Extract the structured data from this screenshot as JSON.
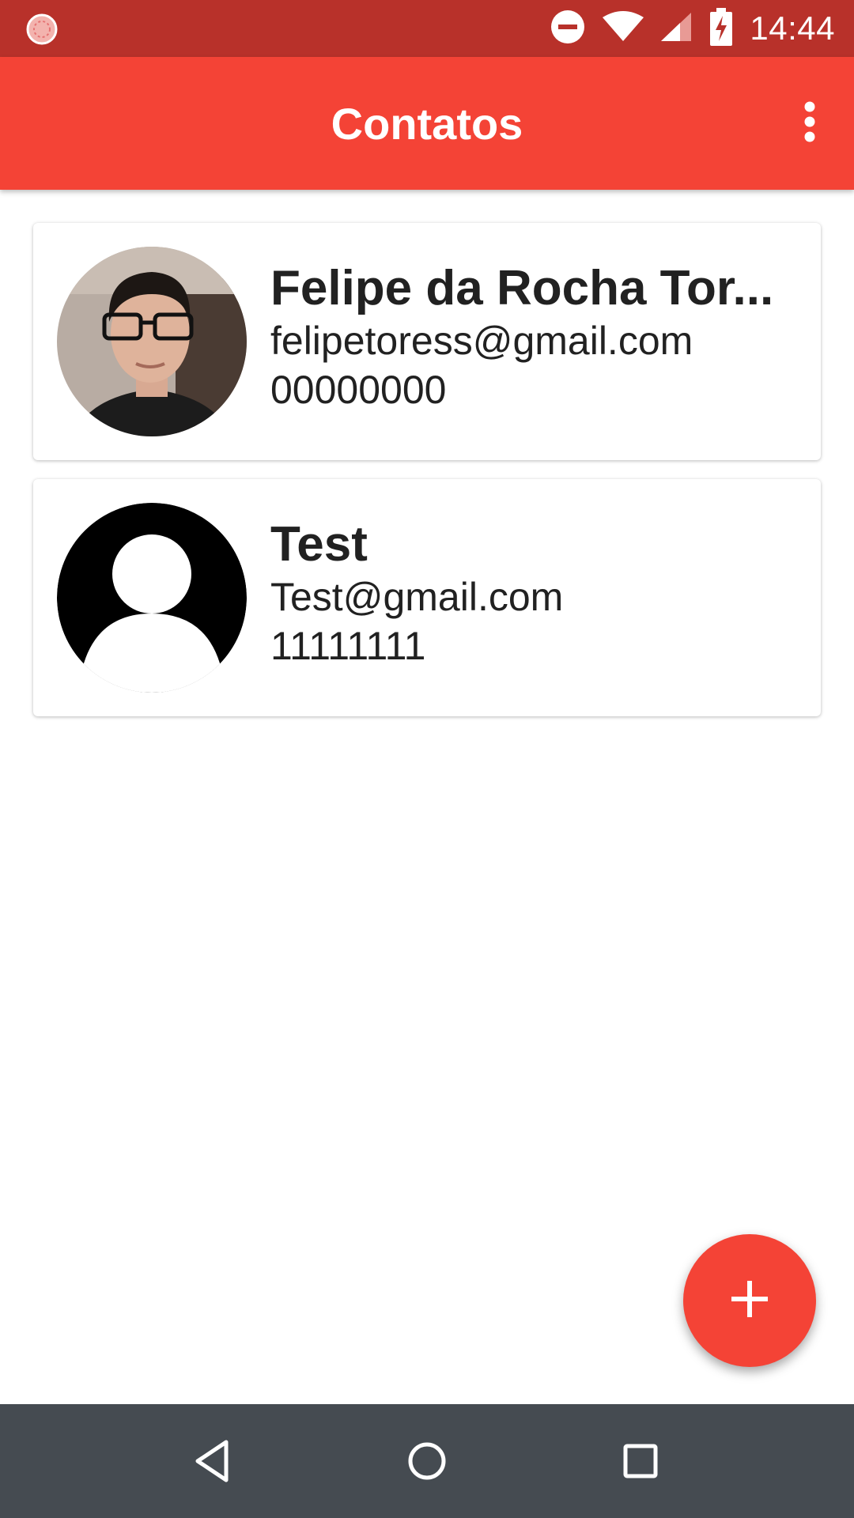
{
  "status_bar": {
    "time": "14:44",
    "icons": [
      "app-notification-icon",
      "do-not-disturb-icon",
      "wifi-icon",
      "cell-signal-icon",
      "battery-charging-icon"
    ],
    "color": "#b8312a"
  },
  "app_bar": {
    "title": "Contatos",
    "color": "#f44336",
    "overflow_icon": "more-vert-icon"
  },
  "contacts": [
    {
      "name": "Felipe da Rocha Tor...",
      "email": "felipetoress@gmail.com",
      "phone": "00000000",
      "avatar": "photo"
    },
    {
      "name": "Test",
      "email": "Test@gmail.com",
      "phone": "11111111",
      "avatar": "default-person-icon"
    }
  ],
  "fab": {
    "icon": "add-icon",
    "color": "#f44336"
  },
  "nav_bar": {
    "icons": [
      "back-icon",
      "home-icon",
      "recents-icon"
    ],
    "color": "#454b51"
  }
}
